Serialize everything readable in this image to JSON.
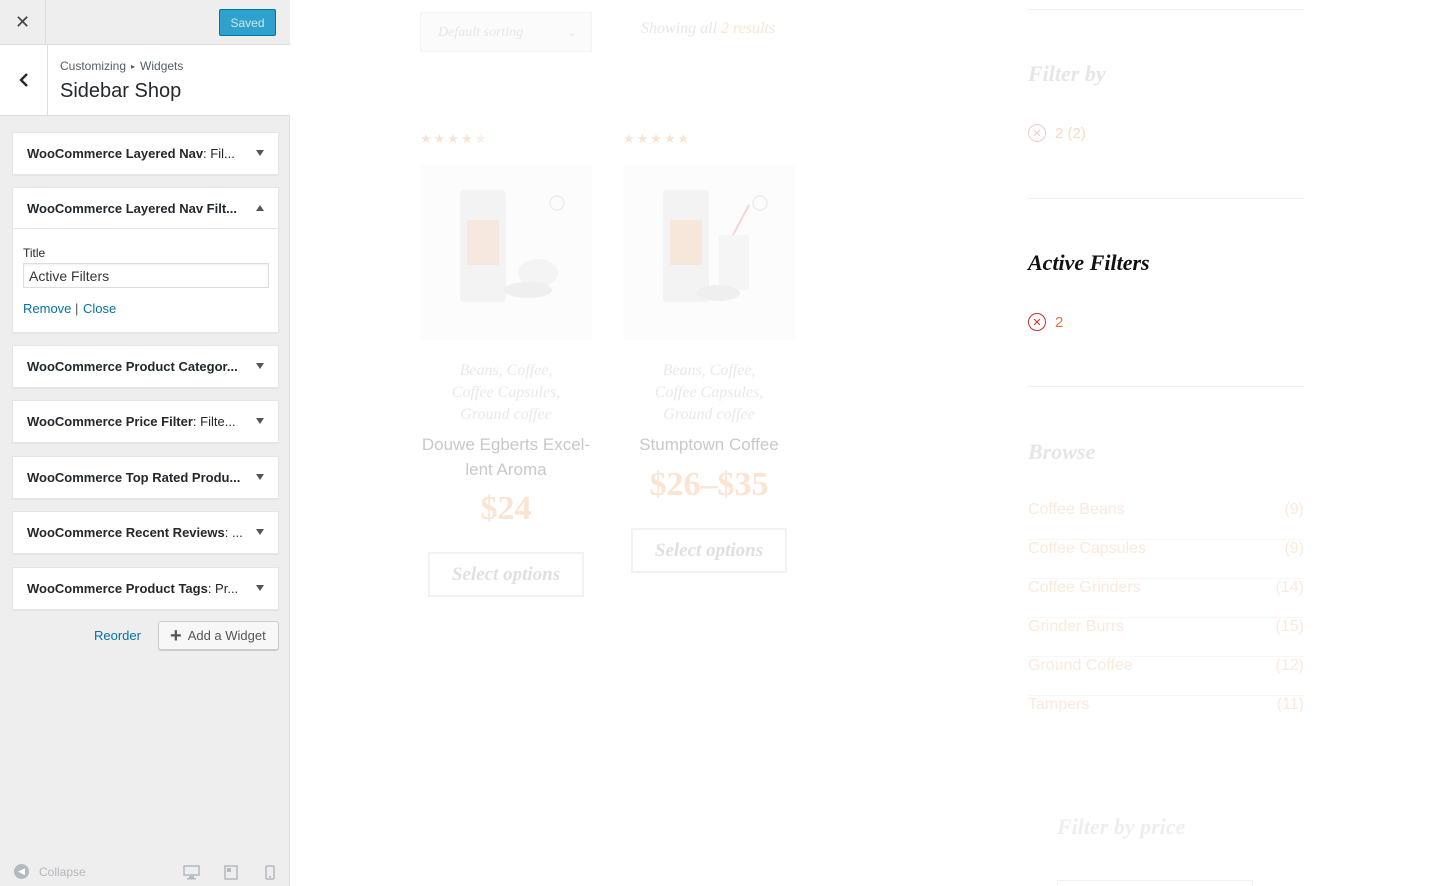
{
  "customizer": {
    "saved_label": "Saved",
    "breadcrumb": {
      "root": "Customizing",
      "sep": "▸",
      "current": "Widgets"
    },
    "section_title": "Sidebar Shop",
    "widgets": [
      {
        "prefix": "WooCommerce Layered Nav",
        "suffix": ": Fil...",
        "state": "collapsed"
      },
      {
        "prefix": "WooCommerce Layered Nav Filt...",
        "suffix": "",
        "state": "expanded"
      },
      {
        "prefix": "WooCommerce Product Categor...",
        "suffix": "",
        "state": "collapsed"
      },
      {
        "prefix": "WooCommerce Price Filter",
        "suffix": ": Filte...",
        "state": "collapsed"
      },
      {
        "prefix": "WooCommerce Top Rated Produ...",
        "suffix": "",
        "state": "collapsed"
      },
      {
        "prefix": "WooCommerce Recent Reviews",
        "suffix": ": ...",
        "state": "collapsed"
      },
      {
        "prefix": "WooCommerce Product Tags",
        "suffix": ": Pr...",
        "state": "collapsed"
      }
    ],
    "expanded_form": {
      "title_label": "Title",
      "title_value": "Active Filters",
      "remove_label": "Remove",
      "separator": "|",
      "close_label": "Close"
    },
    "reorder_label": "Reorder",
    "add_widget_label": "Add a Widget",
    "collapse_label": "Collapse"
  },
  "preview": {
    "sorting": "Default sorting",
    "results_prefix": "Showing all",
    "results_highlight": "2 results",
    "products": [
      {
        "categories": [
          "Beans, Coffee,",
          "Coffee Capsules,",
          "Ground coffee"
        ],
        "name": [
          "Douwe Egberts Excel-",
          "lent Aroma"
        ],
        "price": "$24",
        "button": "Select options",
        "rating": 4.5
      },
      {
        "categories": [
          "Beans, Coffee,",
          "Coffee Capsules,",
          "Ground coffee"
        ],
        "name": [
          "Stumptown Coffee"
        ],
        "price": "$26–$35",
        "button": "Select options",
        "rating": 5
      }
    ],
    "filter_by": {
      "title": "Filter by",
      "chip": "2 (2)"
    },
    "active_filters": {
      "title": "Active Filters",
      "chip": "2"
    },
    "browse": {
      "title": "Browse",
      "categories": [
        {
          "name": "Coffee Beans",
          "count": "(9)"
        },
        {
          "name": "Coffee Capsules",
          "count": "(9)"
        },
        {
          "name": "Coffee Grinders",
          "count": "(14)"
        },
        {
          "name": "Grinder Burrs",
          "count": "(15)"
        },
        {
          "name": "Ground Coffee",
          "count": "(12)"
        },
        {
          "name": "Tampers",
          "count": "(11)"
        }
      ]
    },
    "filter_by_price": {
      "title": "Filter by price"
    }
  },
  "colors": {
    "accent_blue": "#0073aa",
    "saved_button": "#2ea2cc",
    "active_filter_text": "#e0763f",
    "remove_icon": "#c9302c"
  }
}
